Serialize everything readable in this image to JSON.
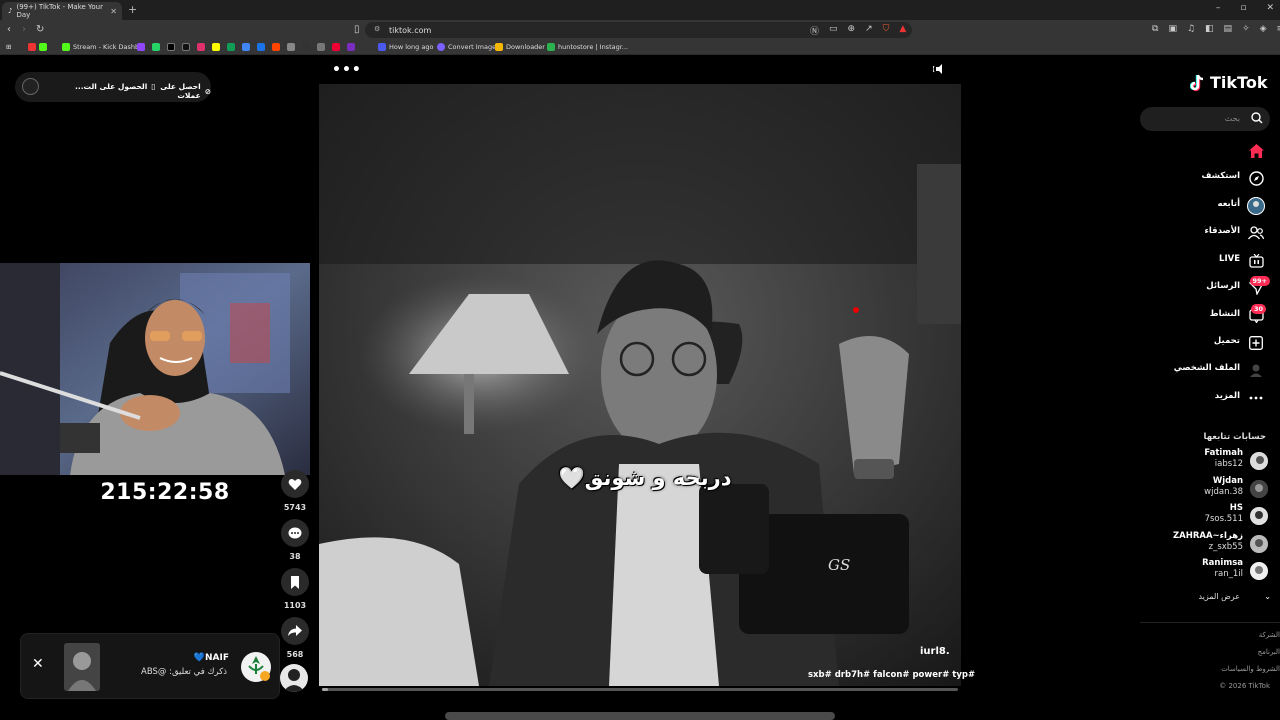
{
  "browser": {
    "tab_title": "(99+) TikTok - Make Your Day",
    "url": "tiktok.com",
    "bookmarks": [
      {
        "label": "Stream - Kick Dashb...",
        "color": "#53fc18"
      },
      {
        "label": "How long ago",
        "color": "#4a5aef"
      },
      {
        "label": "Convert Image",
        "color": "#7b61ff"
      },
      {
        "label": "Downloader",
        "color": "#f5b700"
      },
      {
        "label": "huntostore | Instagr...",
        "color": "#2bb24c"
      }
    ]
  },
  "top_pill": {
    "get_app": "الحصول على الت...",
    "get_coins": "احصل على عملات"
  },
  "stream": {
    "timer": "215:22:58"
  },
  "video": {
    "subtitle": "دربحه و شونق🤍",
    "watermark": "GS",
    "creator_handle": "iurl8.",
    "caption": "sxb# drb7h# falcon# power# typ#",
    "progress": 0.01,
    "actions": {
      "likes": "5743",
      "comments": "38",
      "saves": "1103",
      "shares": "568"
    }
  },
  "toast": {
    "name": "NAIF💙",
    "text": "ذكرك في تعليق: @ABS"
  },
  "sidebar": {
    "logo": "TikTok",
    "search_placeholder": "بحث",
    "nav": {
      "foryou": "",
      "explore": "استكشف",
      "following": "أتابعه",
      "friends": "الأصدقاء",
      "live": "LIVE",
      "messages": "الرسائل",
      "messages_badge": "99+",
      "activity": "النشاط",
      "activity_badge": "30",
      "upload": "تحميل",
      "profile": "الملف الشخصي",
      "more": "المزيد"
    },
    "following_title": "حسابات تتابعها",
    "accounts": [
      {
        "name": "Fatimah",
        "handle": "iabs12"
      },
      {
        "name": "Wjdan",
        "handle": "wjdan.38"
      },
      {
        "name": "HS",
        "handle": "7sos.511"
      },
      {
        "name": "ZAHRAA~زهراء",
        "handle": "z_sxb55"
      },
      {
        "name": "Ranimsa",
        "handle": "ran_1il"
      }
    ],
    "see_more": "عرض المزيد",
    "footer": [
      "الشركة",
      "البرنامج",
      "الشروط والسياسات",
      "© 2026 TikTok"
    ]
  },
  "colors": {
    "accent": "#fe2c55",
    "badge": "#fe2c55"
  }
}
